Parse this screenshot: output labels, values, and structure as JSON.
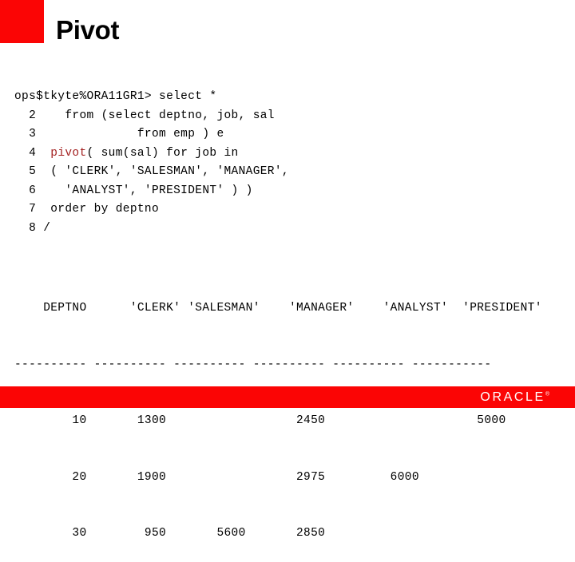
{
  "slide": {
    "title": "Pivot",
    "accent_color": "#fb0505",
    "background_color": "#ffffff",
    "text_color": "#000000"
  },
  "terminal": {
    "prompt_line": "ops$tkyte%ORA11GR1> select *",
    "keyword_color": "#a32020",
    "lines": [
      {
        "num": "  2",
        "text": "    from (select deptno, job, sal"
      },
      {
        "num": "  3",
        "text": "              from emp ) e"
      },
      {
        "num": "  4",
        "keyword": "pivot",
        "text_before": "  ",
        "text_after": "( sum(sal) for job in"
      },
      {
        "num": "  5",
        "text": "  ( 'CLERK', 'SALESMAN', 'MANAGER',"
      },
      {
        "num": "  6",
        "text": "    'ANALYST', 'PRESIDENT' ) )"
      },
      {
        "num": "  7",
        "text": "  order by deptno"
      },
      {
        "num": "  8",
        "text": " /"
      }
    ]
  },
  "result": {
    "header": "    DEPTNO      'CLERK' 'SALESMAN'    'MANAGER'    'ANALYST'  'PRESIDENT'",
    "separator": "---------- ---------- ---------- ---------- ---------- -----------",
    "columns": [
      "DEPTNO",
      "'CLERK'",
      "'SALESMAN'",
      "'MANAGER'",
      "'ANALYST'",
      "'PRESIDENT'"
    ],
    "rows": [
      {
        "cells": [
          "10",
          "1300",
          "",
          "2450",
          "",
          "5000"
        ],
        "text": "        10       1300                  2450                     5000"
      },
      {
        "cells": [
          "20",
          "1900",
          "",
          "2975",
          "6000",
          ""
        ],
        "text": "        20       1900                  2975         6000"
      },
      {
        "cells": [
          "30",
          "950",
          "5600",
          "2850",
          "",
          ""
        ],
        "text": "        30        950       5600       2850"
      }
    ]
  },
  "footer": {
    "logo_text": "ORACLE",
    "trademark": "®",
    "bar_color": "#fb0505",
    "logo_color": "#ffffff"
  }
}
